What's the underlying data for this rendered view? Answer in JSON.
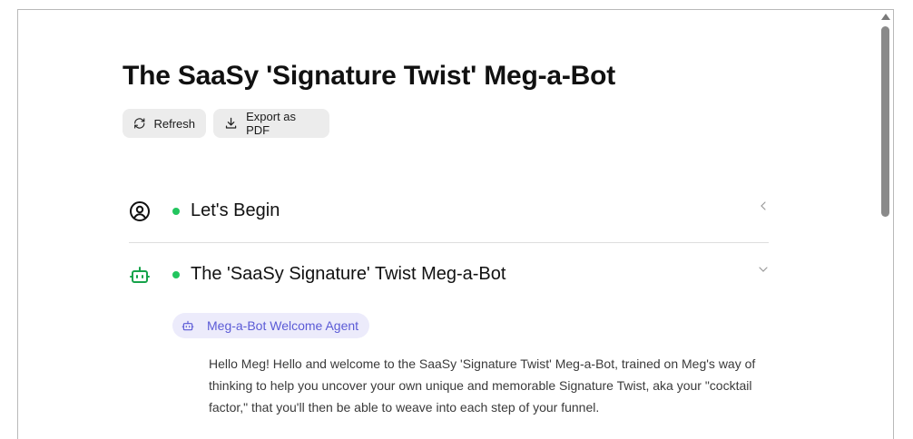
{
  "page": {
    "title": "The SaaSy 'Signature Twist' Meg-a-Bot"
  },
  "toolbar": {
    "refresh_label": "Refresh",
    "export_label": "Export as PDF"
  },
  "sections": [
    {
      "title": "Let's Begin",
      "icon": "user-circle-icon",
      "state": "collapsed"
    },
    {
      "title": "The 'SaaSy Signature' Twist Meg-a-Bot",
      "icon": "bot-icon",
      "state": "expanded"
    }
  ],
  "agent": {
    "name": "Meg-a-Bot Welcome Agent",
    "icon": "bot-icon"
  },
  "message": {
    "paragraph1": "Hello Meg! Hello and welcome to the SaaSy 'Signature Twist' Meg-a-Bot, trained on Meg's way of thinking to help you uncover your own unique and memorable Signature Twist, aka your \"cocktail factor,\" that you'll then be able to weave into each step of your funnel."
  },
  "colors": {
    "status_dot": "#22c55e",
    "bot_icon": "#16a34a",
    "agent_pill_bg": "#ecebfb",
    "agent_text": "#5b5bd6",
    "button_bg": "#ececec"
  }
}
